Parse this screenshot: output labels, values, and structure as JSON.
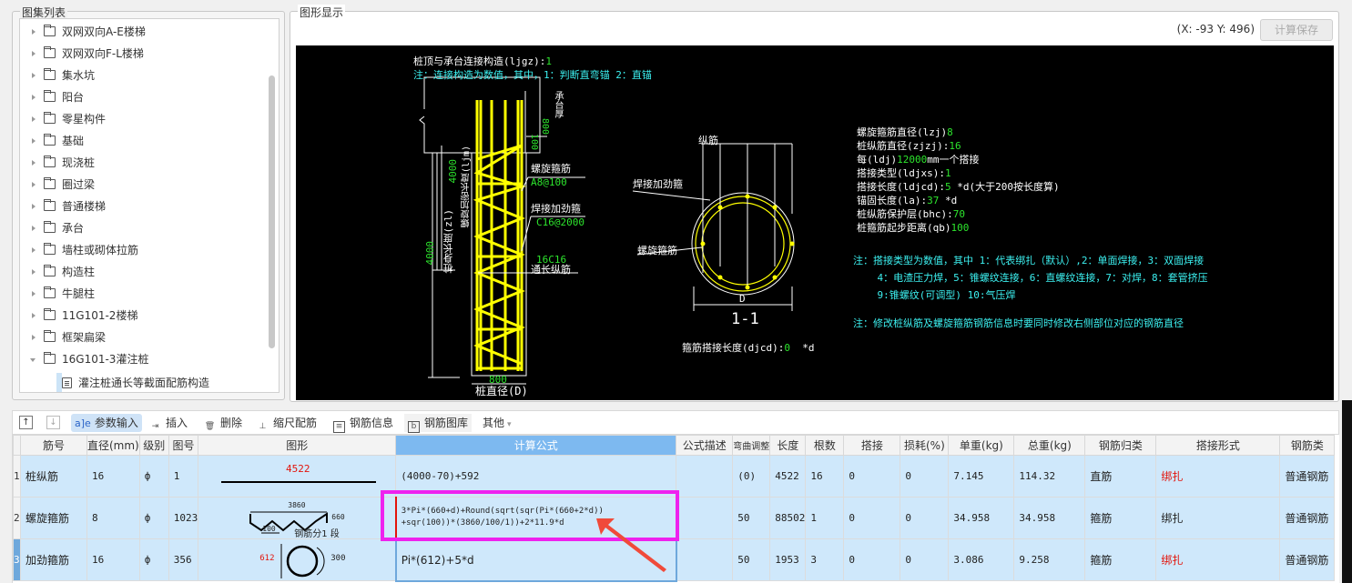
{
  "tree_panel": {
    "title": "图集列表",
    "items": [
      {
        "label": "双网双向A-E楼梯",
        "type": "folder",
        "expanded": false
      },
      {
        "label": "双网双向F-L楼梯",
        "type": "folder",
        "expanded": false
      },
      {
        "label": "集水坑",
        "type": "folder",
        "expanded": false
      },
      {
        "label": "阳台",
        "type": "folder",
        "expanded": false
      },
      {
        "label": "零星构件",
        "type": "folder",
        "expanded": false
      },
      {
        "label": "基础",
        "type": "folder",
        "expanded": false
      },
      {
        "label": "现浇桩",
        "type": "folder",
        "expanded": false
      },
      {
        "label": "圈过梁",
        "type": "folder",
        "expanded": false
      },
      {
        "label": "普通楼梯",
        "type": "folder",
        "expanded": false
      },
      {
        "label": "承台",
        "type": "folder",
        "expanded": false
      },
      {
        "label": "墙柱或砌体拉筋",
        "type": "folder",
        "expanded": false
      },
      {
        "label": "构造柱",
        "type": "folder",
        "expanded": false
      },
      {
        "label": "牛腿柱",
        "type": "folder",
        "expanded": false
      },
      {
        "label": "11G101-2楼梯",
        "type": "folder",
        "expanded": false
      },
      {
        "label": "框架扁梁",
        "type": "folder",
        "expanded": false
      },
      {
        "label": "16G101-3灌注桩",
        "type": "folder",
        "expanded": true
      }
    ],
    "selected_leaf": "灌注桩通长等截面配筋构造"
  },
  "graphic_panel": {
    "title": "图形显示",
    "coord_readout": "(X: -93 Y: 496)",
    "save_button": "计算保存",
    "drawing": {
      "top_label": "桩顶与承台连接构造(ljgz):",
      "top_value": "1",
      "top_note": "注：连接构造为数值，其中，1：判断直弯锚    2：直锚",
      "cap_thickness": "承台厚",
      "dim_800_top": "800",
      "dim_100": "100",
      "spiral_label": "螺旋箍筋",
      "spiral_spec": "A8@100",
      "weld_label": "焊接加劲箍",
      "weld_spec": "C16@2000",
      "long_spec": "16C16",
      "long_label": "通长纵筋",
      "dense_len": "4000",
      "dense_label": "螺旋加密长度(ljm)",
      "body_len": "4000",
      "body_label": "桩身长度(zl)",
      "dia_dim": "800",
      "dia_label": "桩直径(D)",
      "section_long": "纵筋",
      "section_weld": "焊接加劲箍",
      "section_spiral": "螺旋箍筋",
      "section_D": "D",
      "section_title": "1-1",
      "lap_label": "箍筋搭接长度(djcd):",
      "lap_value": "0",
      "lap_unit": "*d",
      "params": [
        {
          "label": "螺旋箍筋直径(lzj)",
          "value": "8",
          "suffix": ""
        },
        {
          "label": "桩纵筋直径(zjzj):",
          "value": "16",
          "suffix": ""
        },
        {
          "label": "每(ldj)",
          "value": "12000",
          "suffix": "mm一个搭接"
        },
        {
          "label": "搭接类型(ldjxs):",
          "value": "1",
          "suffix": ""
        },
        {
          "label": "搭接长度(ldjcd):",
          "value": "5",
          "suffix": " *d(大于200按长度算)"
        },
        {
          "label": "锚固长度(la):",
          "value": "37",
          "suffix": " *d"
        },
        {
          "label": "桩纵筋保护层(bhc):",
          "value": "70",
          "suffix": ""
        },
        {
          "label": "桩箍筋起步距离(qb)",
          "value": "100",
          "suffix": ""
        }
      ],
      "notes": [
        "注：搭接类型为数值，其中 1：代表绑扎（默认）,2：单面焊接，3：双面焊接",
        "    4：电渣压力焊，5：锥螺纹连接，6：直螺纹连接，7：对焊，8：套管挤压",
        "    9:锥螺纹(可调型) 10:气压焊",
        "注：修改桩纵筋及螺旋箍筋钢筋信息时要同时修改右侧部位对应的钢筋直径"
      ]
    }
  },
  "toolbar": {
    "param_input": "参数输入",
    "insert": "插入",
    "delete": "删除",
    "scale_rebar": "缩尺配筋",
    "rebar_info": "钢筋信息",
    "rebar_library": "钢筋图库",
    "other": "其他"
  },
  "table": {
    "columns": [
      "筋号",
      "直径(mm)",
      "级别",
      "图号",
      "图形",
      "计算公式",
      "公式描述",
      "弯曲调整",
      "长度",
      "根数",
      "搭接",
      "损耗(%)",
      "单重(kg)",
      "总重(kg)",
      "钢筋归类",
      "搭接形式",
      "钢筋类"
    ],
    "rows": [
      {
        "num": "1",
        "name": "桩纵筋",
        "dia": "16",
        "grade": "ф",
        "fig": "1",
        "shape": {
          "length": "4522"
        },
        "formula": "(4000-70)+592",
        "desc": "",
        "bend": "(0)",
        "len": "4522",
        "count": "16",
        "lap": "0",
        "loss": "0",
        "unit_w": "7.145",
        "total_w": "114.32",
        "category": "直筋",
        "lap_type": "绑扎",
        "lap_type_red": true,
        "rebar_type": "普通钢筋"
      },
      {
        "num": "2",
        "name": "螺旋箍筋",
        "dia": "8",
        "grade": "ф",
        "fig": "1023",
        "shape": {
          "top": "3860",
          "pitch": "100",
          "height": "660",
          "seg": "钢筋分1 段"
        },
        "formula_line1": "3*Pi*(660+d)+Round(sqrt(sqr(Pi*(660+2*d))",
        "formula_line2": "+sqr(100))*(3860/100/1))+2*11.9*d",
        "desc": "",
        "bend": "50",
        "len": "88502",
        "count": "1",
        "lap": "0",
        "loss": "0",
        "unit_w": "34.958",
        "total_w": "34.958",
        "category": "箍筋",
        "lap_type": "绑扎",
        "lap_type_red": false,
        "rebar_type": "普通钢筋"
      },
      {
        "num": "3",
        "name": "加劲箍筋",
        "dia": "16",
        "grade": "ф",
        "fig": "356",
        "shape": {
          "dia": "612",
          "lap": "300"
        },
        "formula": "Pi*(612)+5*d",
        "desc": "",
        "bend": "50",
        "len": "1953",
        "count": "3",
        "lap": "0",
        "loss": "0",
        "unit_w": "3.086",
        "total_w": "9.258",
        "category": "箍筋",
        "lap_type": "绑扎",
        "lap_type_red": true,
        "rebar_type": "普通钢筋"
      }
    ]
  },
  "colors": {
    "accent": "#7db9f0",
    "row_bg": "#cfe8fb",
    "highlight": "#ee22ee",
    "arrow": "#f04a3a",
    "cad_green": "#2de52d",
    "cad_cyan": "#3cf0f0",
    "cad_yellow": "#ffff00"
  }
}
